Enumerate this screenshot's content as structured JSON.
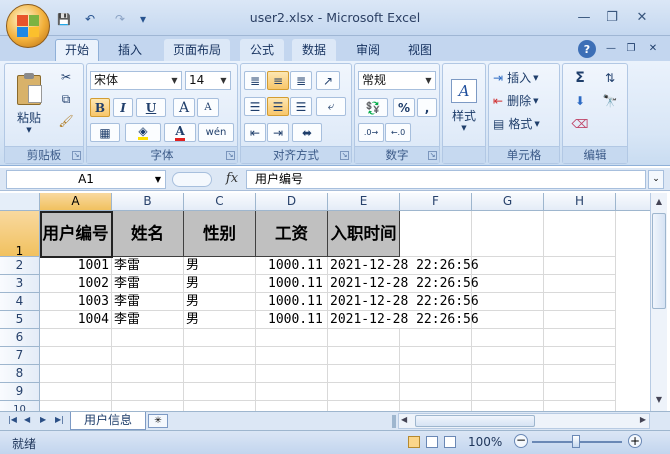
{
  "window": {
    "title": "user2.xlsx - Microsoft Excel"
  },
  "qat": {
    "save": "💾",
    "undo": "↶",
    "redo": "↷",
    "customize": "▾"
  },
  "wincontrols": {
    "minimize": "—",
    "restore": "❐",
    "close": "✕",
    "help": "?",
    "inner_min": "—",
    "inner_restore": "❐",
    "inner_close": "✕"
  },
  "tabs": [
    "开始",
    "插入",
    "页面布局",
    "公式",
    "数据",
    "审阅",
    "视图"
  ],
  "ribbon": {
    "clipboard": {
      "label": "剪贴板",
      "paste": "粘贴"
    },
    "font": {
      "label": "字体",
      "name": "宋体",
      "size": "14",
      "bold": "B",
      "italic": "I",
      "underline": "U",
      "grow": "A",
      "shrink": "A",
      "wen": "wén"
    },
    "alignment": {
      "label": "对齐方式"
    },
    "number": {
      "label": "数字",
      "format": "常规",
      "percent": "%",
      "comma": ","
    },
    "styles": {
      "label": "样式"
    },
    "cells": {
      "label": "单元格",
      "insert": "插入",
      "delete": "删除",
      "format": "格式"
    },
    "editing": {
      "label": "编辑",
      "sigma": "Σ"
    }
  },
  "formula_bar": {
    "name_box": "A1",
    "fx": "fx",
    "content": "用户编号"
  },
  "columns": [
    "A",
    "B",
    "C",
    "D",
    "E",
    "F",
    "G",
    "H"
  ],
  "rows": [
    "1",
    "2",
    "3",
    "4",
    "5",
    "6",
    "7",
    "8",
    "9",
    "10"
  ],
  "table": {
    "headers": [
      "用户编号",
      "姓名",
      "性别",
      "工资",
      "入职时间"
    ],
    "data": [
      [
        "1001",
        "李雷",
        "男",
        "1000.11",
        "2021-12-28  22:26:56"
      ],
      [
        "1002",
        "李雷",
        "男",
        "1000.11",
        "2021-12-28  22:26:56"
      ],
      [
        "1003",
        "李雷",
        "男",
        "1000.11",
        "2021-12-28  22:26:56"
      ],
      [
        "1004",
        "李雷",
        "男",
        "1000.11",
        "2021-12-28  22:26:56"
      ]
    ]
  },
  "sheet_tabs": {
    "active": "用户信息"
  },
  "status": {
    "ready": "就绪",
    "zoom": "100%"
  }
}
